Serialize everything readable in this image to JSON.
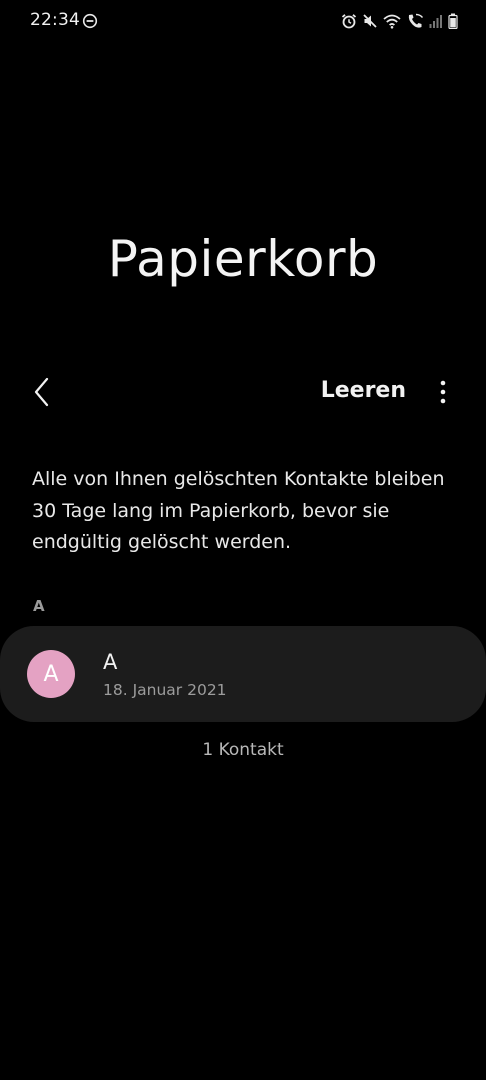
{
  "status_bar": {
    "time": "22:34",
    "icons": [
      "do-not-disturb-icon",
      "alarm-icon",
      "mute-icon",
      "wifi-icon",
      "wifi-calling-icon",
      "signal-icon",
      "battery-icon"
    ]
  },
  "header": {
    "title": "Papierkorb"
  },
  "toolbar": {
    "back_icon": "chevron-left-icon",
    "empty_label": "Leeren",
    "more_icon": "more-vertical-icon"
  },
  "info": {
    "text": "Alle von Ihnen gelöschten Kontakte bleiben 30 Tage lang im Papierkorb, bevor sie endgültig gelöscht werden."
  },
  "list": {
    "section_letter": "A",
    "contacts": [
      {
        "avatar_letter": "A",
        "avatar_color": "#e4a2c3",
        "name": "A",
        "date": "18. Januar 2021"
      }
    ],
    "count_text": "1 Kontakt"
  },
  "colors": {
    "background": "#000000",
    "card": "#1c1c1c",
    "text_primary": "#f2f2f2",
    "text_secondary": "#9c9c9c"
  }
}
